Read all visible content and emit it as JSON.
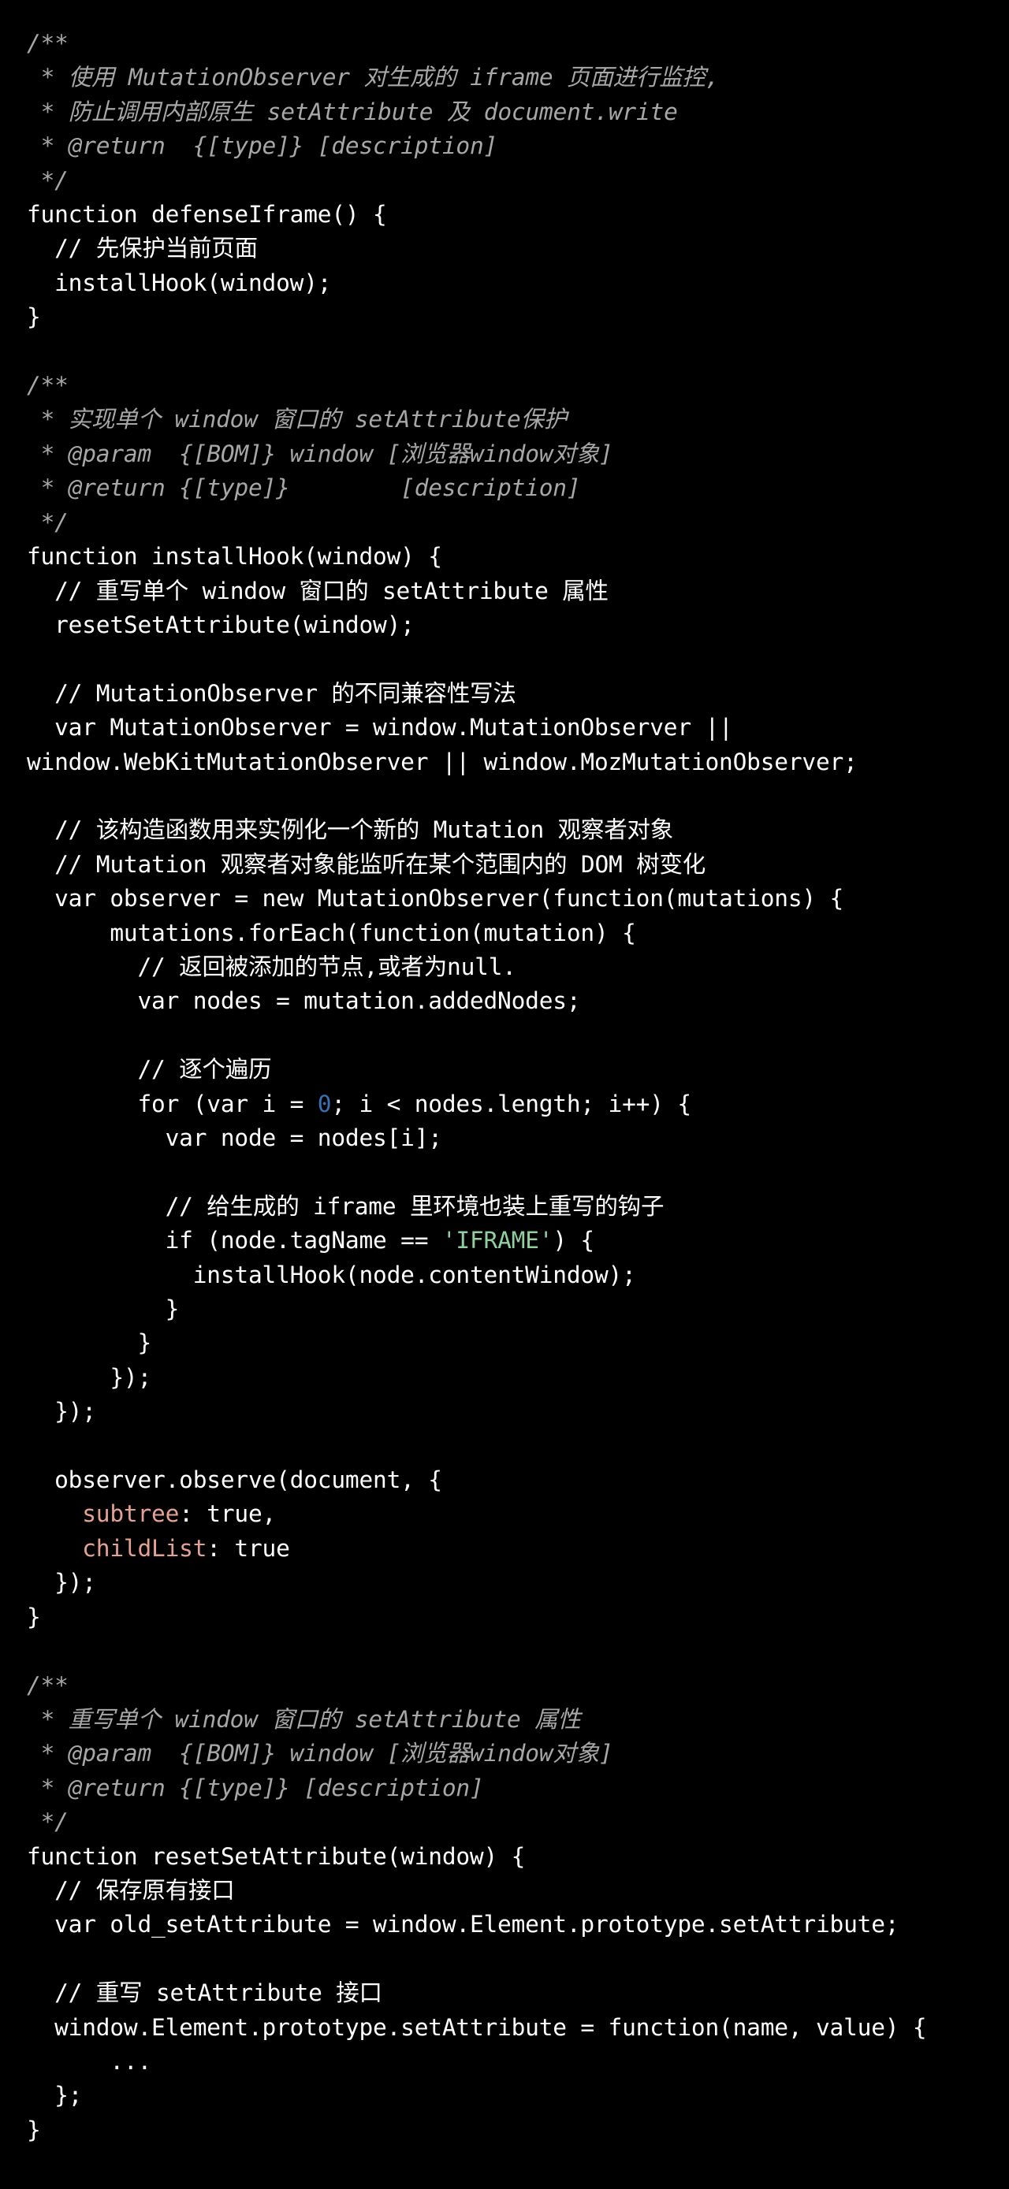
{
  "editor": {
    "background_color": "#000000",
    "default_text_color": "#ffffff",
    "comment_block_color": "#a7a7a7",
    "number_color": "#3b6fb5",
    "string_color": "#8fcfa0",
    "property_color": "#e5a294",
    "language": "JavaScript"
  },
  "code": {
    "lines": [
      {
        "id": "l1",
        "kind": "comment-block",
        "text": "/**"
      },
      {
        "id": "l2",
        "kind": "comment-block",
        "text": " * 使用 MutationObserver 对生成的 iframe 页面进行监控,"
      },
      {
        "id": "l3",
        "kind": "comment-block",
        "text": " * 防止调用内部原生 setAttribute 及 document.write"
      },
      {
        "id": "l4",
        "kind": "comment-block",
        "text": " * @return  {[type]} [description]"
      },
      {
        "id": "l5",
        "kind": "comment-block",
        "text": " */"
      },
      {
        "id": "l6",
        "kind": "code",
        "text": "function defenseIframe() {"
      },
      {
        "id": "l7",
        "kind": "comment-line",
        "text": "  // 先保护当前页面"
      },
      {
        "id": "l8",
        "kind": "code",
        "text": "  installHook(window);"
      },
      {
        "id": "l9",
        "kind": "code",
        "text": "}"
      },
      {
        "id": "l10",
        "kind": "blank",
        "text": ""
      },
      {
        "id": "l11",
        "kind": "comment-block",
        "text": "/**"
      },
      {
        "id": "l12",
        "kind": "comment-block",
        "text": " * 实现单个 window 窗口的 setAttribute保护"
      },
      {
        "id": "l13",
        "kind": "comment-block",
        "text": " * @param  {[BOM]} window [浏览器window对象]"
      },
      {
        "id": "l14",
        "kind": "comment-block",
        "text": " * @return {[type]}        [description]"
      },
      {
        "id": "l15",
        "kind": "comment-block",
        "text": " */"
      },
      {
        "id": "l16",
        "kind": "code",
        "text": "function installHook(window) {"
      },
      {
        "id": "l17",
        "kind": "comment-line",
        "text": "  // 重写单个 window 窗口的 setAttribute 属性"
      },
      {
        "id": "l18",
        "kind": "code",
        "text": "  resetSetAttribute(window);"
      },
      {
        "id": "l19",
        "kind": "blank",
        "text": ""
      },
      {
        "id": "l20",
        "kind": "comment-line",
        "text": "  // MutationObserver 的不同兼容性写法"
      },
      {
        "id": "l21",
        "kind": "code",
        "text": "  var MutationObserver = window.MutationObserver || window.WebKitMutationObserver || window.MozMutationObserver;"
      },
      {
        "id": "l22",
        "kind": "blank",
        "text": ""
      },
      {
        "id": "l23",
        "kind": "comment-line",
        "text": "  // 该构造函数用来实例化一个新的 Mutation 观察者对象"
      },
      {
        "id": "l24",
        "kind": "comment-line",
        "text": "  // Mutation 观察者对象能监听在某个范围内的 DOM 树变化"
      },
      {
        "id": "l25",
        "kind": "code",
        "text": "  var observer = new MutationObserver(function(mutations) {"
      },
      {
        "id": "l26",
        "kind": "code",
        "text": "      mutations.forEach(function(mutation) {"
      },
      {
        "id": "l27",
        "kind": "comment-line",
        "text": "        // 返回被添加的节点,或者为null."
      },
      {
        "id": "l28",
        "kind": "code",
        "text": "        var nodes = mutation.addedNodes;"
      },
      {
        "id": "l29",
        "kind": "blank",
        "text": ""
      },
      {
        "id": "l30",
        "kind": "comment-line",
        "text": "        // 逐个遍历"
      },
      {
        "id": "l31",
        "kind": "code-number",
        "text": "        for (var i = 0; i < nodes.length; i++) {",
        "number_token": "0"
      },
      {
        "id": "l32",
        "kind": "code",
        "text": "          var node = nodes[i];"
      },
      {
        "id": "l33",
        "kind": "blank",
        "text": ""
      },
      {
        "id": "l34",
        "kind": "comment-line",
        "text": "          // 给生成的 iframe 里环境也装上重写的钩子"
      },
      {
        "id": "l35",
        "kind": "code-string",
        "text": "          if (node.tagName == 'IFRAME') {",
        "string_token": "'IFRAME'"
      },
      {
        "id": "l36",
        "kind": "code",
        "text": "            installHook(node.contentWindow);"
      },
      {
        "id": "l37",
        "kind": "code",
        "text": "          }"
      },
      {
        "id": "l38",
        "kind": "code",
        "text": "        }"
      },
      {
        "id": "l39",
        "kind": "code",
        "text": "      });"
      },
      {
        "id": "l40",
        "kind": "code",
        "text": "  });"
      },
      {
        "id": "l41",
        "kind": "blank",
        "text": ""
      },
      {
        "id": "l42",
        "kind": "code",
        "text": "  observer.observe(document, {"
      },
      {
        "id": "l43",
        "kind": "code-property",
        "text": "    subtree: true,",
        "property_token": "subtree"
      },
      {
        "id": "l44",
        "kind": "code-property",
        "text": "    childList: true",
        "property_token": "childList"
      },
      {
        "id": "l45",
        "kind": "code",
        "text": "  });"
      },
      {
        "id": "l46",
        "kind": "code",
        "text": "}"
      },
      {
        "id": "l47",
        "kind": "blank",
        "text": ""
      },
      {
        "id": "l48",
        "kind": "comment-block",
        "text": "/**"
      },
      {
        "id": "l49",
        "kind": "comment-block",
        "text": " * 重写单个 window 窗口的 setAttribute 属性"
      },
      {
        "id": "l50",
        "kind": "comment-block",
        "text": " * @param  {[BOM]} window [浏览器window对象]"
      },
      {
        "id": "l51",
        "kind": "comment-block",
        "text": " * @return {[type]} [description]"
      },
      {
        "id": "l52",
        "kind": "comment-block",
        "text": " */"
      },
      {
        "id": "l53",
        "kind": "code",
        "text": "function resetSetAttribute(window) {"
      },
      {
        "id": "l54",
        "kind": "comment-line",
        "text": "  // 保存原有接口"
      },
      {
        "id": "l55",
        "kind": "code",
        "text": "  var old_setAttribute = window.Element.prototype.setAttribute;"
      },
      {
        "id": "l56",
        "kind": "blank",
        "text": ""
      },
      {
        "id": "l57",
        "kind": "comment-line",
        "text": "  // 重写 setAttribute 接口"
      },
      {
        "id": "l58",
        "kind": "code",
        "text": "  window.Element.prototype.setAttribute = function(name, value) {"
      },
      {
        "id": "l59",
        "kind": "code",
        "text": "      ..."
      },
      {
        "id": "l60",
        "kind": "code",
        "text": "  };"
      },
      {
        "id": "l61",
        "kind": "code",
        "text": "}"
      }
    ]
  }
}
